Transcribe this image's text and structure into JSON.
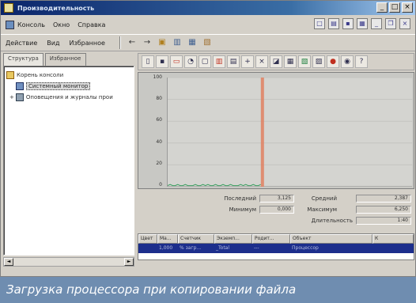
{
  "window": {
    "title": "Производительность",
    "controls": [
      "_",
      "□",
      "×"
    ]
  },
  "menubar": {
    "items": [
      {
        "label": "Консоль"
      },
      {
        "label": "Окно"
      },
      {
        "label": "Справка"
      }
    ],
    "right_icons": [
      "new-window-icon",
      "open-icon",
      "save-icon",
      "console-icon",
      "minimize-icon",
      "restore-icon",
      "close-icon"
    ]
  },
  "toolbar": {
    "items": [
      {
        "label": "Действие"
      },
      {
        "label": "Вид"
      },
      {
        "label": "Избранное"
      }
    ],
    "nav_back": "←",
    "nav_forward": "→"
  },
  "left_pane": {
    "tabs": [
      "Структура",
      "Избранное"
    ],
    "active_tab": 0,
    "tree": [
      {
        "label": "Корень консоли",
        "icon": "folder-icon",
        "level": 0,
        "selected": false
      },
      {
        "label": "Системный монитор",
        "icon": "monitor-icon",
        "level": 1,
        "selected": true
      },
      {
        "label": "Оповещения и журналы прои",
        "icon": "log-icon",
        "level": 1,
        "selected": false
      }
    ]
  },
  "perf_toolbar": {
    "buttons": [
      "new-counter-icon",
      "clear-icon",
      "view-current-icon",
      "view-log-icon",
      "view-graph-icon",
      "view-histogram-icon",
      "view-report-icon",
      "add-counter-icon",
      "delete-counter-icon",
      "highlight-icon",
      "copy-icon",
      "paste-icon",
      "properties-icon",
      "freeze-icon",
      "update-icon",
      "help-icon"
    ]
  },
  "chart_data": {
    "type": "line",
    "ylim": [
      0,
      100
    ],
    "y_ticks": [
      "100",
      "80",
      "60",
      "40",
      "20",
      "0"
    ],
    "cursor_position": 0.38,
    "series": [
      {
        "name": "",
        "color": "#3aa060",
        "values": [
          1,
          2,
          1,
          1,
          2,
          1,
          1,
          2,
          1,
          1,
          1,
          2,
          1,
          1,
          2,
          1,
          2,
          1,
          1,
          2,
          1,
          1,
          2,
          1,
          1,
          2,
          1,
          1,
          1,
          2,
          1,
          2,
          1,
          1,
          2,
          1,
          1,
          2
        ]
      }
    ],
    "spike_color": "#e08060"
  },
  "stats": {
    "last_label": "Последний",
    "last_value": "3,125",
    "avg_label": "Средний",
    "avg_value": "2,387",
    "min_label": "Минимум",
    "min_value": "0,000",
    "max_label": "Максимум",
    "max_value": "6,250",
    "duration_label": "Длительность",
    "duration_value": "1:40"
  },
  "counter_table": {
    "headers": [
      "Цвет",
      "Ма...",
      "Счетчик",
      "Экземп...",
      "Родит...",
      "Объект",
      "К"
    ],
    "rows": [
      {
        "color": "",
        "scale": "1,000",
        "counter": "% загр...",
        "instance": "_Total",
        "parent": "---",
        "object": "Процессор",
        "computer": ""
      }
    ]
  },
  "caption": {
    "text": "Загрузка процессора при копировании файла"
  }
}
